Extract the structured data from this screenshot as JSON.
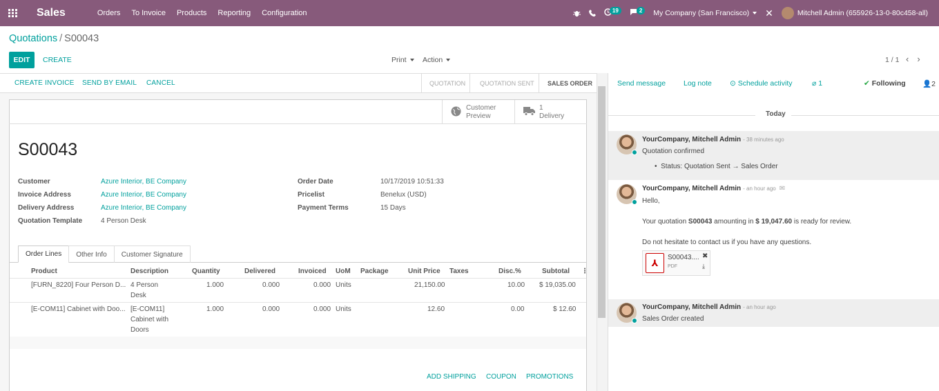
{
  "navbar": {
    "app": "Sales",
    "menu": [
      "Orders",
      "To Invoice",
      "Products",
      "Reporting",
      "Configuration"
    ],
    "activity_count": "19",
    "message_count": "2",
    "company": "My Company (San Francisco)",
    "user": "Mitchell Admin (655926-13-0-80c458-all)"
  },
  "breadcrumb": {
    "parent": "Quotations",
    "separator": "/",
    "current": "S00043"
  },
  "control": {
    "edit": "EDIT",
    "create": "CREATE",
    "print": "Print",
    "action": "Action",
    "pager": "1 / 1",
    "prev": "‹",
    "next": "›"
  },
  "header": {
    "buttons": [
      "CREATE INVOICE",
      "SEND BY EMAIL",
      "CANCEL"
    ],
    "stages": [
      "QUOTATION",
      "QUOTATION SENT",
      "SALES ORDER"
    ]
  },
  "smart_buttons": {
    "preview": [
      "Customer",
      "Preview"
    ],
    "delivery": [
      "1",
      "Delivery"
    ]
  },
  "form": {
    "name": "S00043",
    "left_labels": [
      "Customer",
      "Invoice Address",
      "Delivery Address",
      "Quotation Template"
    ],
    "left_values": [
      "Azure Interior, BE Company",
      "Azure Interior, BE Company",
      "Azure Interior, BE Company",
      "4 Person Desk"
    ],
    "right_labels": [
      "Order Date",
      "Pricelist",
      "Payment Terms"
    ],
    "right_values": [
      "10/17/2019 10:51:33",
      "Benelux (USD)",
      "15 Days"
    ]
  },
  "tabs": [
    "Order Lines",
    "Other Info",
    "Customer Signature"
  ],
  "table": {
    "headers": [
      "Product",
      "Description",
      "Quantity",
      "Delivered",
      "Invoiced",
      "UoM",
      "Package",
      "Unit Price",
      "Taxes",
      "Disc.%",
      "Subtotal"
    ],
    "rows": [
      {
        "product": "[FURN_8220] Four Person D...",
        "desc": [
          "4 Person",
          "Desk"
        ],
        "qty": "1.000",
        "delivered": "0.000",
        "invoiced": "0.000",
        "uom": "Units",
        "price": "21,150.00",
        "disc": "10.00",
        "subtotal": "$ 19,035.00"
      },
      {
        "product": "[E-COM11] Cabinet with Doo...",
        "desc": [
          "[E-COM11]",
          "Cabinet with",
          "Doors"
        ],
        "qty": "1.000",
        "delivered": "0.000",
        "invoiced": "0.000",
        "uom": "Units",
        "price": "12.60",
        "disc": "0.00",
        "subtotal": "$ 12.60"
      }
    ],
    "footer_buttons": [
      "ADD SHIPPING",
      "COUPON",
      "PROMOTIONS"
    ]
  },
  "chatter": {
    "send_message": "Send message",
    "log_note": "Log note",
    "schedule": "Schedule activity",
    "attachments": "1",
    "following": "Following",
    "followers": "2",
    "today": "Today",
    "messages": [
      {
        "author": "YourCompany, Mitchell Admin",
        "ago": "- 38 minutes ago",
        "lines": [
          "Quotation confirmed"
        ],
        "bullet": "Status: Quotation Sent → Sales Order"
      },
      {
        "author": "YourCompany, Mitchell Admin",
        "ago": "- an hour ago",
        "greeting": "Hello,",
        "body_pre": "Your quotation ",
        "body_ref": "S00043",
        "body_mid": " amounting in ",
        "body_amount": "$ 19,047.60",
        "body_post": " is ready for review.",
        "closing": "Do not hesitate to contact us if you have any questions.",
        "attachment_name": "S00043....",
        "attachment_type": "PDF"
      },
      {
        "author": "YourCompany, Mitchell Admin",
        "ago": "- an hour ago",
        "lines": [
          "Sales Order created"
        ]
      }
    ]
  },
  "colors": {
    "brand": "#875a7b",
    "accent": "#00a09d"
  },
  "icons": [
    "apps-grid-icon",
    "bug-icon",
    "phone-icon",
    "activity-clock-icon",
    "chat-icon",
    "close-icon",
    "globe-icon",
    "truck-icon",
    "paperclip-icon",
    "check-icon",
    "user-icon",
    "envelope-icon",
    "pdf-icon",
    "download-icon"
  ]
}
